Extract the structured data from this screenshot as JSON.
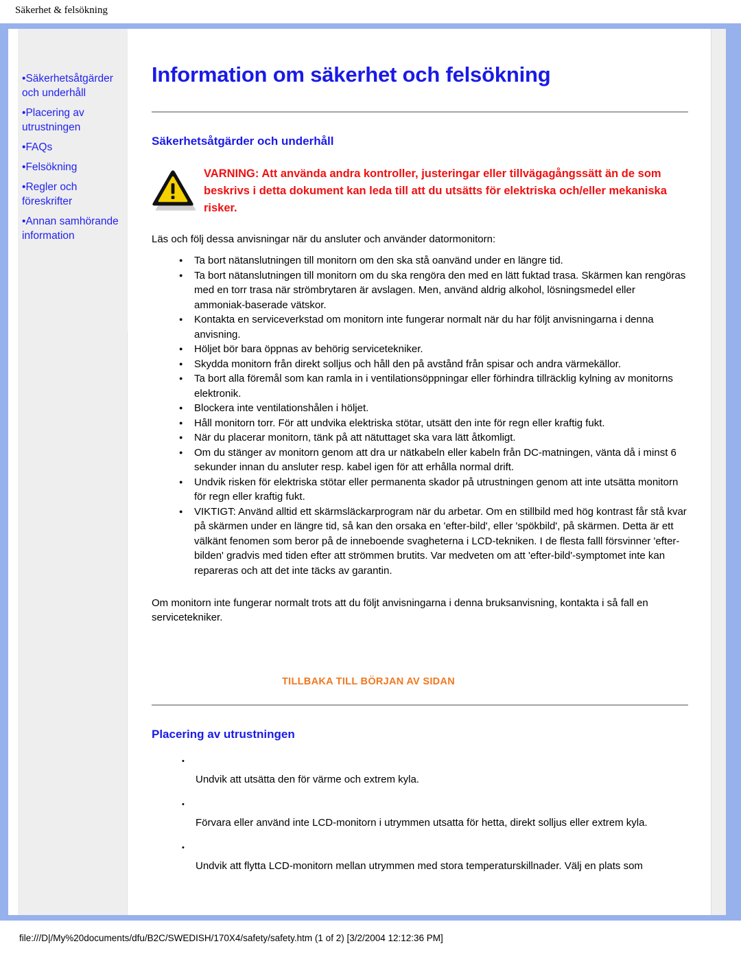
{
  "window": {
    "title": "Säkerhet & felsökning"
  },
  "sidebar": {
    "items": [
      {
        "bullet": "•",
        "label": "Säkerhetsåtgärder och underhåll"
      },
      {
        "bullet": "•",
        "label": "Placering av utrustningen"
      },
      {
        "bullet": "•",
        "label": "FAQs"
      },
      {
        "bullet": "•",
        "label": "Felsökning"
      },
      {
        "bullet": "•",
        "label": "Regler och föreskrifter"
      },
      {
        "bullet": "•",
        "label": "Annan samhörande information"
      }
    ]
  },
  "main": {
    "title": "Information om säkerhet och felsökning",
    "section1": {
      "heading": "Säkerhetsåtgärder och underhåll",
      "warning": "VARNING: Att använda andra kontroller, justeringar eller tillvägagångssätt än de som beskrivs i detta dokument kan leda till att du utsätts för elektriska och/eller mekaniska risker.",
      "intro": "Läs och följ dessa anvisningar när du ansluter och använder datormonitorn:",
      "bullets": [
        "Ta bort nätanslutningen till monitorn om den ska stå oanvänd under en längre tid.",
        "Ta bort nätanslutningen till monitorn om du ska rengöra den med en lätt fuktad trasa. Skärmen kan rengöras med en torr trasa när strömbrytaren är avslagen. Men, använd aldrig alkohol, lösningsmedel eller ammoniak-baserade vätskor.",
        "Kontakta en serviceverkstad om monitorn inte fungerar normalt när du har följt anvisningarna i denna anvisning.",
        "Höljet bör bara öppnas av behörig servicetekniker.",
        "Skydda monitorn från direkt solljus och håll den på avstånd från spisar och andra värmekällor.",
        "Ta bort alla föremål som kan ramla in i ventilationsöppningar eller förhindra tillräcklig kylning av monitorns elektronik.",
        "Blockera inte ventilationshålen i höljet.",
        "Håll monitorn torr. För att undvika elektriska stötar, utsätt den inte för regn eller kraftig fukt.",
        "När du placerar monitorn, tänk på att nätuttaget ska vara lätt åtkomligt.",
        "Om du stänger av monitorn genom att dra ur nätkabeln eller kabeln från DC-matningen, vänta då i minst 6 sekunder innan du ansluter resp. kabel igen för att erhålla normal drift.",
        "Undvik risken för elektriska stötar eller permanenta skador på utrustningen genom att inte utsätta monitorn för regn eller kraftig fukt.",
        "VIKTIGT: Använd alltid ett skärmsläckarprogram när du arbetar. Om en stillbild med hög kontrast får stå kvar på skärmen under en längre tid, så kan den orsaka en 'efter-bild', eller 'spökbild', på skärmen. Detta är ett välkänt fenomen som beror på de inneboende svagheterna i LCD-tekniken. I de flesta falll försvinner 'efter-bilden' gradvis med tiden efter att strömmen brutits. Var medveten om att 'efter-bild'-symptomet inte kan repareras och att det inte täcks av garantin."
      ],
      "closing": "Om monitorn inte fungerar normalt trots att du följt anvisningarna i denna bruksanvisning, kontakta i så fall en servicetekniker.",
      "back_to_top": "TILLBAKA TILL BÖRJAN AV SIDAN"
    },
    "section2": {
      "heading": "Placering av utrustningen",
      "marker": "•",
      "bullets": [
        "Undvik att utsätta den för värme och extrem kyla.",
        "Förvara eller använd inte LCD-monitorn i utrymmen utsatta för hetta, direkt solljus eller extrem kyla.",
        "Undvik att flytta LCD-monitorn mellan utrymmen med stora temperaturskillnader. Välj en plats som"
      ]
    }
  },
  "status_bar": {
    "text": "file:///D|/My%20documents/dfu/B2C/SWEDISH/170X4/safety/safety.htm (1 of 2) [3/2/2004 12:12:36 PM]"
  },
  "colors": {
    "frame_blue": "#97b1ec",
    "link_blue": "#2222ee",
    "heading_blue": "#1a1ae6",
    "warning_red": "#ee1111",
    "back_link_orange": "#f07820",
    "panel_gray": "#eeeeee"
  },
  "icons": {
    "warning_triangle": "warning-triangle-icon"
  }
}
